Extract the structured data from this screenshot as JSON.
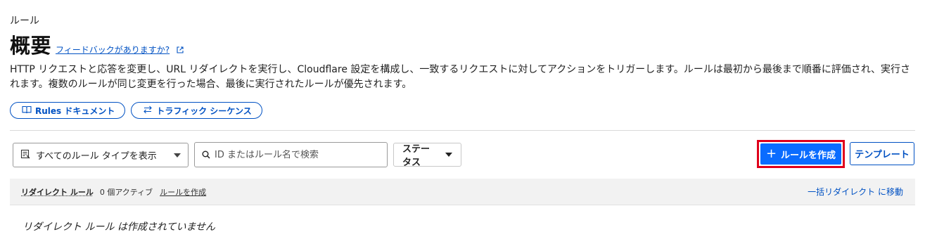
{
  "header": {
    "breadcrumb": "ルール",
    "title": "概要",
    "feedback_link": "フィードバックがありますか?"
  },
  "description": "HTTP リクエストと応答を変更し、URL リダイレクトを実行し、Cloudflare 設定を構成し、一致するリクエストに対してアクションをトリガーします。ルールは最初から最後まで順番に評価され、実行されます。複数のルールが同じ変更を行った場合、最後に実行されたルールが優先されます。",
  "links": {
    "rules_docs": "Rules ドキュメント",
    "traffic_sequence": "トラフィック シーケンス"
  },
  "toolbar": {
    "type_select_value": "すべてのルール タイプを表示",
    "search_placeholder": "ID またはルール名で検索",
    "status_label": "ステータス",
    "create_label": "ルールを作成",
    "template_label": "テンプレート"
  },
  "section": {
    "name": "リダイレクト ルール",
    "count": "0 個アクティブ",
    "create_link": "ルールを作成",
    "bulk_link": "一括リダイレクト に移動",
    "empty_text": "リダイレクト ルール は作成されていません"
  },
  "colors": {
    "accent": "#0051c3",
    "primary_button": "#0a6cff",
    "highlight_border": "#e0001b"
  },
  "icons": {
    "external": "external-link-icon",
    "book": "book-icon",
    "swap": "swap-arrows-icon",
    "filter": "filter-list-icon",
    "search": "search-icon",
    "plus": "plus-icon",
    "caret": "caret-down-icon"
  }
}
